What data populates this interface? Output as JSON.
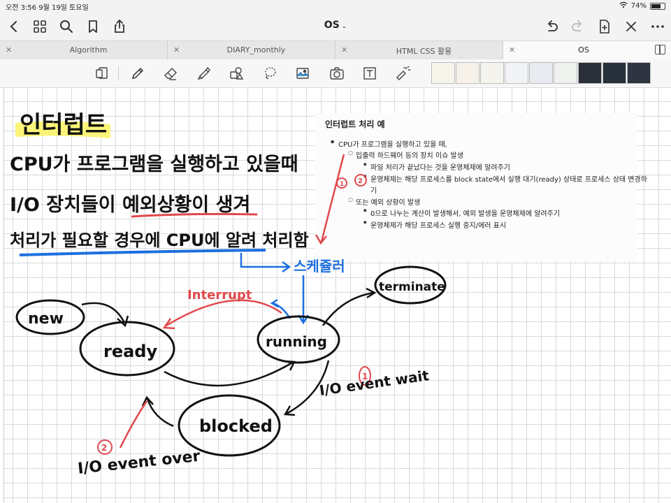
{
  "status_bar": {
    "time_date": "오전 3:56  9월 19일 토요일",
    "battery": "74%",
    "battery_level": 0.74
  },
  "nav": {
    "title": "OS"
  },
  "tabs": [
    {
      "label": "Algorithm",
      "active": false
    },
    {
      "label": "DIARY_monthly",
      "active": false
    },
    {
      "label": "HTML CSS 활용",
      "active": false
    },
    {
      "label": "OS",
      "active": true
    }
  ],
  "toolbar": {
    "tools": [
      "pages-icon",
      "pen-icon",
      "eraser-icon",
      "highlighter-icon",
      "shapes-icon",
      "lasso-icon",
      "image-icon",
      "camera-icon",
      "text-icon",
      "laser-icon"
    ],
    "thumbnail_count": 8
  },
  "note": {
    "title": "인터럽트 처리 예",
    "lines": [
      "CPU가 프로그램을 실행하고 있을 때,",
      "입출력 하드웨어 등의 장치 이슈 발생",
      "파일 처리가 끝났다는 것을 운영체제에 알려주기",
      "운영체제는 해당 프로세스를 block state에서 실행 대기(ready) 상태로 프로세스 상태 변경하",
      "기",
      "또는 예외 상황이 발생",
      "0으로 나누는 계산이 발생해서, 예외 발생을 운영체제에 알려주기",
      "운영체제가 해당 프로세스 실행 중지/에러 표시"
    ]
  },
  "handwriting": {
    "heading": "인터럽트",
    "line1": "CPU가 프로그램을 실행하고 있을때",
    "line2": "I/O 장치들이 예외상황이 생겨",
    "line3": "처리가 필요할 경우에 CPU에 알려 처리함",
    "scheduler": "스케쥴러",
    "interrupt": "Interrupt",
    "states": {
      "new": "new",
      "ready": "ready",
      "running": "running",
      "blocked": "blocked",
      "terminate": "terminate"
    },
    "io_wait": "I/O event wait",
    "io_over": "I/O event over",
    "marker1": "1",
    "marker2": "2"
  }
}
